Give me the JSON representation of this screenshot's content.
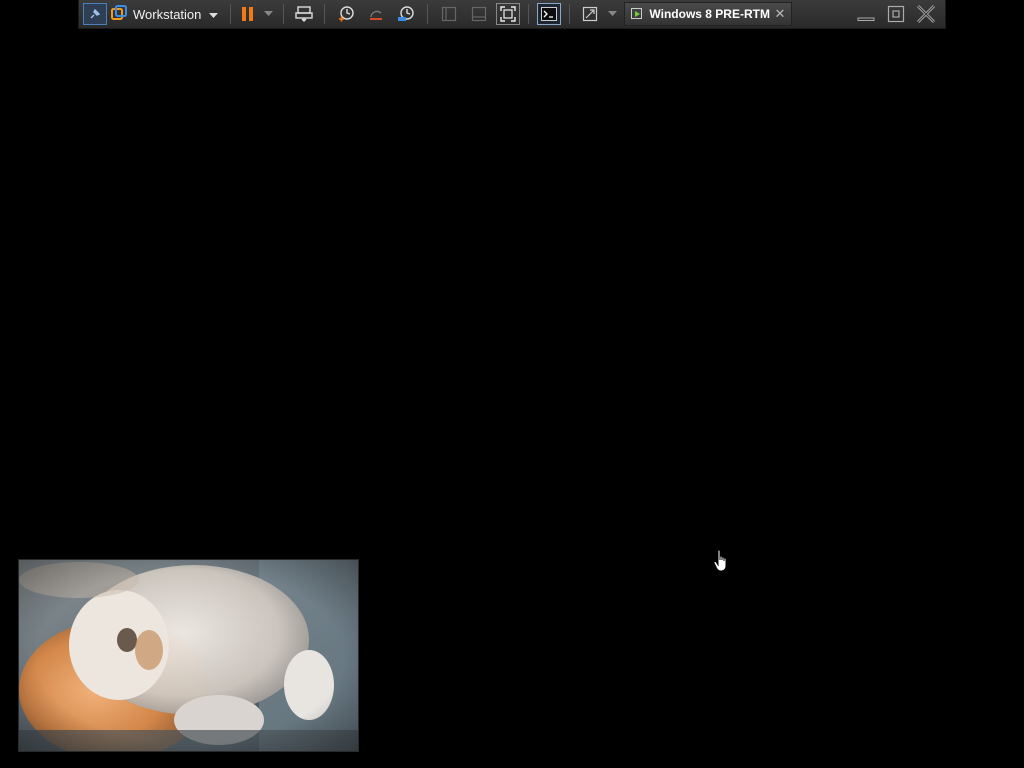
{
  "toolbar": {
    "product_label": "Workstation",
    "vm_tab_label": "Windows 8 PRE-RTM ...",
    "vm_tab_close": "✕",
    "icons": [
      "pin-icon",
      "vmware-logo-icon",
      "dropdown-caret-icon",
      "pause-icon",
      "power-dropdown-icon",
      "send-ctrl-alt-del-icon",
      "snapshot-take-icon",
      "snapshot-revert-icon",
      "snapshot-manager-icon",
      "view-single-icon",
      "view-multi-icon",
      "view-fullscreen-icon",
      "console-icon",
      "stretch-icon",
      "vm-tab-icon",
      "minimize-icon",
      "restore-icon",
      "close-icon"
    ],
    "colors": {
      "pause": "#f07a1a",
      "accent": "#4a7fb8",
      "vmware_orange": "#f39a1e",
      "vmware_blue": "#3a8ee6"
    }
  },
  "webcam": {
    "icon": "webcam-preview-image"
  },
  "cursor": {
    "icon": "hand-pointer-icon"
  }
}
